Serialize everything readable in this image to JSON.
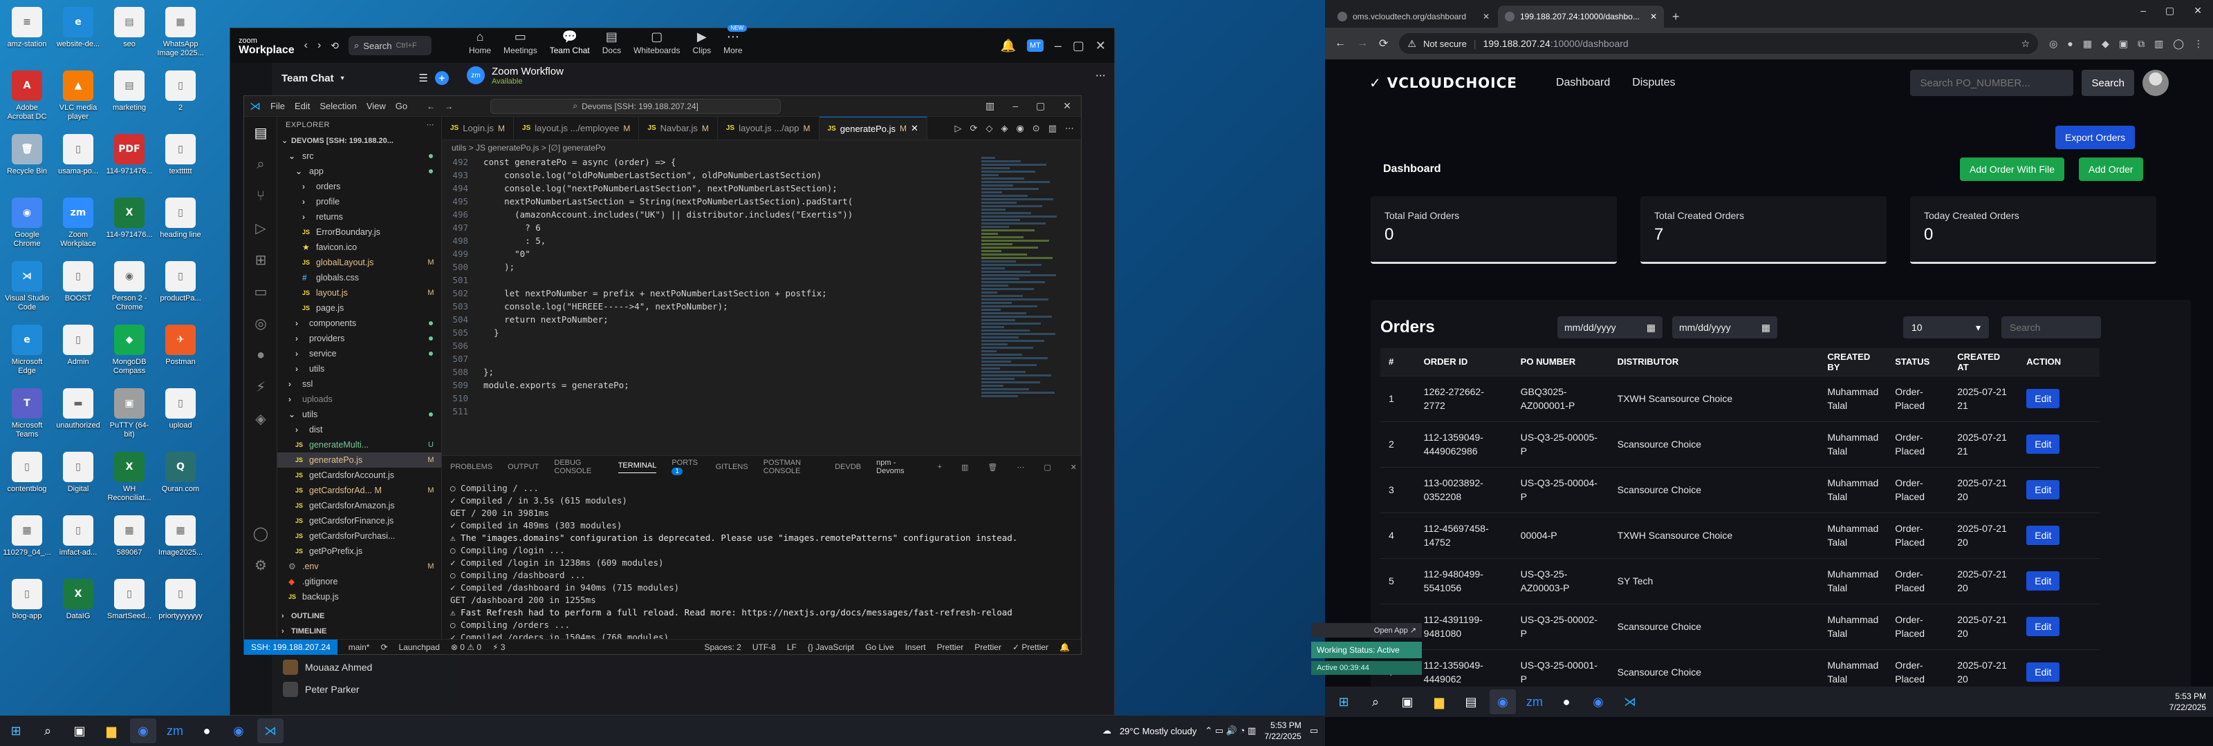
{
  "desktop": {
    "icons": [
      {
        "label": "amz-station",
        "color": "#ffffff",
        "glyph": "≡"
      },
      {
        "label": "website-de...",
        "color": "#1f8ad8",
        "glyph": "e"
      },
      {
        "label": "seo",
        "color": "#ffffff",
        "glyph": "▤"
      },
      {
        "label": "WhatsApp Image 2025...",
        "color": "#ffffff",
        "glyph": "▦"
      },
      {
        "label": "Adobe Acrobat DC",
        "color": "#d32f2f",
        "glyph": "A"
      },
      {
        "label": "VLC media player",
        "color": "#f57c00",
        "glyph": "▲"
      },
      {
        "label": "marketing",
        "color": "#ffffff",
        "glyph": "▤"
      },
      {
        "label": "2",
        "color": "#ffffff",
        "glyph": "▯"
      },
      {
        "label": "Recycle Bin",
        "color": "#9fb4c7",
        "glyph": "🗑"
      },
      {
        "label": "usama-po...",
        "color": "#ffffff",
        "glyph": "▯"
      },
      {
        "label": "114-971476...",
        "color": "#d32f2f",
        "glyph": "PDF"
      },
      {
        "label": "textttttt",
        "color": "#ffffff",
        "glyph": "▯"
      },
      {
        "label": "Google Chrome",
        "color": "#4285f4",
        "glyph": "◉"
      },
      {
        "label": "Zoom Workplace",
        "color": "#2d8cff",
        "glyph": "zm"
      },
      {
        "label": "114-971476...",
        "color": "#1d7a3e",
        "glyph": "X"
      },
      {
        "label": "heading line",
        "color": "#ffffff",
        "glyph": "▯"
      },
      {
        "label": "Visual Studio Code",
        "color": "#1f8ad8",
        "glyph": "⋊"
      },
      {
        "label": "BOOST",
        "color": "#ffffff",
        "glyph": "▯"
      },
      {
        "label": "Person 2 - Chrome",
        "color": "#ffffff",
        "glyph": "◉"
      },
      {
        "label": "productPa...",
        "color": "#ffffff",
        "glyph": "▯"
      },
      {
        "label": "Microsoft Edge",
        "color": "#1f8ad8",
        "glyph": "e"
      },
      {
        "label": "Admin",
        "color": "#ffffff",
        "glyph": "▯"
      },
      {
        "label": "MongoDB Compass",
        "color": "#13aa52",
        "glyph": "◆"
      },
      {
        "label": "Postman",
        "color": "#ef5b25",
        "glyph": "✈"
      },
      {
        "label": "Microsoft Teams",
        "color": "#5b5fc7",
        "glyph": "T"
      },
      {
        "label": "unauthorized",
        "color": "#ffffff",
        "glyph": "▬"
      },
      {
        "label": "PuTTY (64-bit)",
        "color": "#9e9e9e",
        "glyph": "▣"
      },
      {
        "label": "upload",
        "color": "#ffffff",
        "glyph": "▯"
      },
      {
        "label": "contentblog",
        "color": "#ffffff",
        "glyph": "▯"
      },
      {
        "label": "Digital",
        "color": "#ffffff",
        "glyph": "▯"
      },
      {
        "label": "WH Reconciliat...",
        "color": "#1d7a3e",
        "glyph": "X"
      },
      {
        "label": "Quran.com",
        "color": "#2a6f6f",
        "glyph": "Q"
      },
      {
        "label": "110279_04_...",
        "color": "#ffffff",
        "glyph": "▦"
      },
      {
        "label": "imfact-ad...",
        "color": "#ffffff",
        "glyph": "▯"
      },
      {
        "label": "589067",
        "color": "#ffffff",
        "glyph": "▦"
      },
      {
        "label": "Image2025...",
        "color": "#ffffff",
        "glyph": "▦"
      },
      {
        "label": "blog-app",
        "color": "#ffffff",
        "glyph": "▯"
      },
      {
        "label": "DataIG",
        "color": "#1d7a3e",
        "glyph": "X"
      },
      {
        "label": "SmartSeed...",
        "color": "#ffffff",
        "glyph": "▯"
      },
      {
        "label": "priortyyyyyyy",
        "color": "#ffffff",
        "glyph": "▯"
      }
    ]
  },
  "zoom": {
    "brand_line1": "zoom",
    "brand_line2": "Workplace",
    "search_label": "Search",
    "search_shortcut": "Ctrl+F",
    "nav": [
      {
        "label": "Home",
        "icon": "⌂"
      },
      {
        "label": "Meetings",
        "icon": "▭"
      },
      {
        "label": "Team Chat",
        "icon": "💬"
      },
      {
        "label": "Docs",
        "icon": "▤"
      },
      {
        "label": "Whiteboards",
        "icon": "▢"
      },
      {
        "label": "Clips",
        "icon": "▶"
      },
      {
        "label": "More",
        "icon": "⋯",
        "badge": "NEW"
      }
    ],
    "avatar_initials": "MT",
    "panel_title": "Team Chat",
    "workflow_title": "Zoom Workflow",
    "workflow_status": "Available",
    "people": [
      "Mouaaz Ahmed",
      "Peter Parker"
    ]
  },
  "vscode": {
    "menu": [
      "File",
      "Edit",
      "Selection",
      "View",
      "Go"
    ],
    "command_center": "Devoms [SSH: 199.188.207.24]",
    "explorer_title": "EXPLORER",
    "workspace": "DEVOMS [SSH: 199.188.20...",
    "tree": [
      {
        "name": "src",
        "indent": 1,
        "type": "folder",
        "open": true,
        "status": "dot"
      },
      {
        "name": "app",
        "indent": 2,
        "type": "folder",
        "open": true,
        "status": "dot"
      },
      {
        "name": "orders",
        "indent": 3,
        "type": "folder",
        "open": false,
        "status": ""
      },
      {
        "name": "profile",
        "indent": 3,
        "type": "folder",
        "open": false,
        "status": ""
      },
      {
        "name": "returns",
        "indent": 3,
        "type": "folder",
        "open": false,
        "status": ""
      },
      {
        "name": "ErrorBoundary.js",
        "indent": 3,
        "type": "js",
        "status": ""
      },
      {
        "name": "favicon.ico",
        "indent": 3,
        "type": "ico",
        "status": ""
      },
      {
        "name": "globalLayout.js",
        "indent": 3,
        "type": "js",
        "status": "M"
      },
      {
        "name": "globals.css",
        "indent": 3,
        "type": "css",
        "status": ""
      },
      {
        "name": "layout.js",
        "indent": 3,
        "type": "js",
        "status": "M"
      },
      {
        "name": "page.js",
        "indent": 3,
        "type": "js",
        "status": ""
      },
      {
        "name": "components",
        "indent": 2,
        "type": "folder",
        "open": false,
        "status": "dot"
      },
      {
        "name": "providers",
        "indent": 2,
        "type": "folder",
        "open": false,
        "status": "dot"
      },
      {
        "name": "service",
        "indent": 2,
        "type": "folder",
        "open": false,
        "status": "dot"
      },
      {
        "name": "utils",
        "indent": 2,
        "type": "folder",
        "open": false,
        "status": ""
      },
      {
        "name": "ssl",
        "indent": 1,
        "type": "folder",
        "open": false,
        "status": ""
      },
      {
        "name": "uploads",
        "indent": 1,
        "type": "folder",
        "open": false,
        "status": "gray"
      },
      {
        "name": "utils",
        "indent": 1,
        "type": "folder",
        "open": true,
        "status": "dot"
      },
      {
        "name": "dist",
        "indent": 2,
        "type": "folder",
        "open": false,
        "status": ""
      },
      {
        "name": "generateMulti...",
        "indent": 2,
        "type": "js",
        "status": "U"
      },
      {
        "name": "generatePo.js",
        "indent": 2,
        "type": "js",
        "status": "M",
        "selected": true
      },
      {
        "name": "getCardsforAccount.js",
        "indent": 2,
        "type": "js",
        "status": ""
      },
      {
        "name": "getCardsforAd... M",
        "indent": 2,
        "type": "js",
        "status": "M"
      },
      {
        "name": "getCardsforAmazon.js",
        "indent": 2,
        "type": "js",
        "status": ""
      },
      {
        "name": "getCardsforFinance.js",
        "indent": 2,
        "type": "js",
        "status": ""
      },
      {
        "name": "getCardsforPurchasi...",
        "indent": 2,
        "type": "js",
        "status": ""
      },
      {
        "name": "getPoPrefix.js",
        "indent": 2,
        "type": "js",
        "status": ""
      },
      {
        "name": ".env",
        "indent": 1,
        "type": "env",
        "status": "M"
      },
      {
        "name": ".gitignore",
        "indent": 1,
        "type": "git",
        "status": ""
      },
      {
        "name": "backup.js",
        "indent": 1,
        "type": "js",
        "status": ""
      }
    ],
    "outline_label": "OUTLINE",
    "timeline_label": "TIMELINE",
    "tabs": [
      {
        "label": "Login.js",
        "mark": "M",
        "active": false
      },
      {
        "label": "layout.js .../employee",
        "mark": "M",
        "active": false
      },
      {
        "label": "Navbar.js",
        "mark": "M",
        "active": false
      },
      {
        "label": "layout.js .../app",
        "mark": "M",
        "active": false
      },
      {
        "label": "generatePo.js",
        "mark": "M",
        "active": true
      }
    ],
    "breadcrumb": "utils > JS generatePo.js > [∅] generatePo",
    "code": [
      {
        "no": "492",
        "text": "const generatePo = async (order) => {"
      },
      {
        "no": "493",
        "text": "    console.log(\"oldPoNumberLastSection\", oldPoNumberLastSection)"
      },
      {
        "no": "494",
        "text": "    console.log(\"nextPoNumberLastSection\", nextPoNumberLastSection);"
      },
      {
        "no": "495",
        "text": "    nextPoNumberLastSection = String(nextPoNumberLastSection).padStart("
      },
      {
        "no": "496",
        "text": "      (amazonAccount.includes(\"UK\") || distributor.includes(\"Exertis\"))"
      },
      {
        "no": "497",
        "text": "        ? 6"
      },
      {
        "no": "498",
        "text": "        : 5,"
      },
      {
        "no": "499",
        "text": "      \"0\""
      },
      {
        "no": "500",
        "text": "    );"
      },
      {
        "no": "501",
        "text": ""
      },
      {
        "no": "502",
        "text": "    let nextPoNumber = prefix + nextPoNumberLastSection + postfix;"
      },
      {
        "no": "503",
        "text": "    console.log(\"HEREEE----->4\", nextPoNumber);"
      },
      {
        "no": "504",
        "text": "    return nextPoNumber;"
      },
      {
        "no": "505",
        "text": "  }"
      },
      {
        "no": "506",
        "text": ""
      },
      {
        "no": "507",
        "text": ""
      },
      {
        "no": "508",
        "text": "};"
      },
      {
        "no": "509",
        "text": "module.exports = generatePo;"
      },
      {
        "no": "510",
        "text": ""
      },
      {
        "no": "511",
        "text": ""
      }
    ],
    "panel_tabs": [
      "PROBLEMS",
      "OUTPUT",
      "DEBUG CONSOLE",
      "TERMINAL",
      "PORTS",
      "GITLENS",
      "POSTMAN CONSOLE",
      "DEVDB"
    ],
    "ports_badge": "1",
    "terminal_name": "npm - Devoms",
    "terminal": [
      "○ Compiling / ...",
      "✓ Compiled / in 3.5s (615 modules)",
      "GET / 200 in 3981ms",
      "✓ Compiled in 489ms (303 modules)",
      "⚠ The \"images.domains\" configuration is deprecated. Please use \"images.remotePatterns\" configuration instead.",
      "○ Compiling /login ...",
      "✓ Compiled /login in 1238ms (609 modules)",
      "○ Compiling /dashboard ...",
      "✓ Compiled /dashboard in 940ms (715 modules)",
      "GET /dashboard 200 in 1255ms",
      "⚠ Fast Refresh had to perform a full reload. Read more: https://nextjs.org/docs/messages/fast-refresh-reload",
      "○ Compiling /orders ...",
      "✓ Compiled /orders in 1504ms (768 modules)",
      "▯"
    ],
    "status": {
      "remote": "SSH: 199.188.207.24",
      "branch": "main*",
      "errors": "⊗ 0 ⚠ 0",
      "ports": "⚡ 3",
      "launchpad": "Launchpad",
      "spaces": "Spaces: 2",
      "encoding": "UTF-8",
      "eol": "LF",
      "language": "{} JavaScript",
      "golive": "Go Live",
      "insert": "Insert",
      "prettier1": "Prettier",
      "prettier2": "Prettier",
      "prettier3": "✓ Prettier"
    }
  },
  "taskbar_left": {
    "weather": "29°C  Mostly cloudy",
    "time": "5:53 PM",
    "date": "7/22/2025"
  },
  "chrome": {
    "tabs": [
      {
        "title": "oms.vcloudtech.org/dashboard",
        "active": false
      },
      {
        "title": "199.188.207.24:10000/dashbo...",
        "active": true
      }
    ],
    "not_secure": "Not secure",
    "url_host": "199.188.207.24",
    "url_rest": ":10000/dashboard"
  },
  "app": {
    "brand": "VCLOUDCHOICE",
    "nav": [
      "Dashboard",
      "Disputes"
    ],
    "search_placeholder": "Search PO_NUMBER...",
    "search_button": "Search",
    "export_button": "Export Orders",
    "dashboard_title": "Dashboard",
    "add_file_button": "Add Order With File",
    "add_order_button": "Add Order",
    "stats": [
      {
        "label": "Total Paid Orders",
        "value": "0"
      },
      {
        "label": "Total Created Orders",
        "value": "7"
      },
      {
        "label": "Today Created Orders",
        "value": "0"
      }
    ],
    "orders_title": "Orders",
    "date_placeholder": "mm/dd/yyyy",
    "page_size": "10",
    "table_search_placeholder": "Search",
    "columns": [
      "#",
      "ORDER ID",
      "PO NUMBER",
      "DISTRIBUTOR",
      "CREATED BY",
      "STATUS",
      "CREATED AT",
      "ACTION"
    ],
    "rows": [
      {
        "n": "1",
        "order_id": "1262-272662-2772",
        "po": "GBQ3025-AZ000001-P",
        "distributor": "TXWH Scansource Choice",
        "created_by": "Muhammad Talal",
        "status": "Order-Placed",
        "created_at": "2025-07-21 21",
        "action": "Edit"
      },
      {
        "n": "2",
        "order_id": "112-1359049-4449062986",
        "po": "US-Q3-25-00005-P",
        "distributor": "Scansource Choice",
        "created_by": "Muhammad Talal",
        "status": "Order-Placed",
        "created_at": "2025-07-21 21",
        "action": "Edit"
      },
      {
        "n": "3",
        "order_id": "113-0023892-0352208",
        "po": "US-Q3-25-00004-P",
        "distributor": "Scansource Choice",
        "created_by": "Muhammad Talal",
        "status": "Order-Placed",
        "created_at": "2025-07-21 20",
        "action": "Edit"
      },
      {
        "n": "4",
        "order_id": "112-45697458-14752",
        "po": "00004-P",
        "distributor": "TXWH Scansource Choice",
        "created_by": "Muhammad Talal",
        "status": "Order-Placed",
        "created_at": "2025-07-21 20",
        "action": "Edit"
      },
      {
        "n": "5",
        "order_id": "112-9480499-5541056",
        "po": "US-Q3-25-AZ00003-P",
        "distributor": "SY Tech",
        "created_by": "Muhammad Talal",
        "status": "Order-Placed",
        "created_at": "2025-07-21 20",
        "action": "Edit"
      },
      {
        "n": "6",
        "order_id": "112-4391199-9481080",
        "po": "US-Q3-25-00002-P",
        "distributor": "Scansource Choice",
        "created_by": "Muhammad Talal",
        "status": "Order-Placed",
        "created_at": "2025-07-21 20",
        "action": "Edit"
      },
      {
        "n": "7",
        "order_id": "112-1359049-4449062",
        "po": "US-Q3-25-00001-P",
        "distributor": "Scansource Choice",
        "created_by": "Muhammad Talal",
        "status": "Order-Placed",
        "created_at": "2025-07-21 20",
        "action": "Edit"
      }
    ]
  },
  "taskbar_right": {
    "time": "5:53 PM",
    "date": "7/22/2025"
  },
  "work_status": {
    "open_app": "Open App ↗",
    "status": "Working Status: Active",
    "activity": "Active 00:39:44"
  }
}
